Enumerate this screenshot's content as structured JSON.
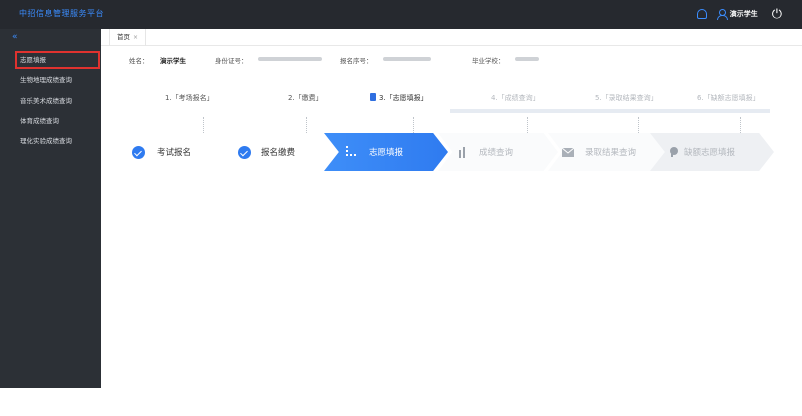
{
  "header": {
    "platform_title": "中招信息管理服务平台",
    "username": "演示学生"
  },
  "sidebar": {
    "collapse_glyph": "«",
    "items": [
      {
        "label": "志愿填报",
        "active": true
      },
      {
        "label": "生物地理成绩查询"
      },
      {
        "label": "音乐美术成绩查询"
      },
      {
        "label": "体育成绩查询"
      },
      {
        "label": "理化实验成绩查询"
      }
    ]
  },
  "tabs": [
    {
      "label": "首页",
      "close": "×"
    }
  ],
  "student_info": {
    "name_label": "姓名：",
    "name_value": "演示学生",
    "id_label": "身份证号：",
    "reg_label": "报名序号：",
    "school_label": "毕业学校："
  },
  "steps": [
    {
      "label": "1.「考场报名」",
      "state": "done"
    },
    {
      "label": "2.「缴费」",
      "state": "done"
    },
    {
      "label": "3.「志愿填报」",
      "state": "current"
    },
    {
      "label": "4.「成绩查询」",
      "state": "todo"
    },
    {
      "label": "5.「录取结果查询」",
      "state": "todo"
    },
    {
      "label": "6.「缺额志愿填报」",
      "state": "todo"
    }
  ],
  "flow": [
    {
      "label": "考试报名",
      "icon": "check-circle-icon",
      "state": "done"
    },
    {
      "label": "报名缴费",
      "icon": "check-circle-icon",
      "state": "done"
    },
    {
      "label": "志愿填报",
      "icon": "list-icon",
      "state": "current"
    },
    {
      "label": "成绩查询",
      "icon": "bar-chart-icon",
      "state": "todo"
    },
    {
      "label": "录取结果查询",
      "icon": "mail-icon",
      "state": "todo"
    },
    {
      "label": "缺额志愿填报",
      "icon": "pin-icon",
      "state": "todo"
    }
  ],
  "colors": {
    "accent": "#3b8dff",
    "topbar": "#26292f",
    "sidebar": "#2c3036",
    "active_border": "#e0322f",
    "current_step": "#2f7bf0"
  }
}
